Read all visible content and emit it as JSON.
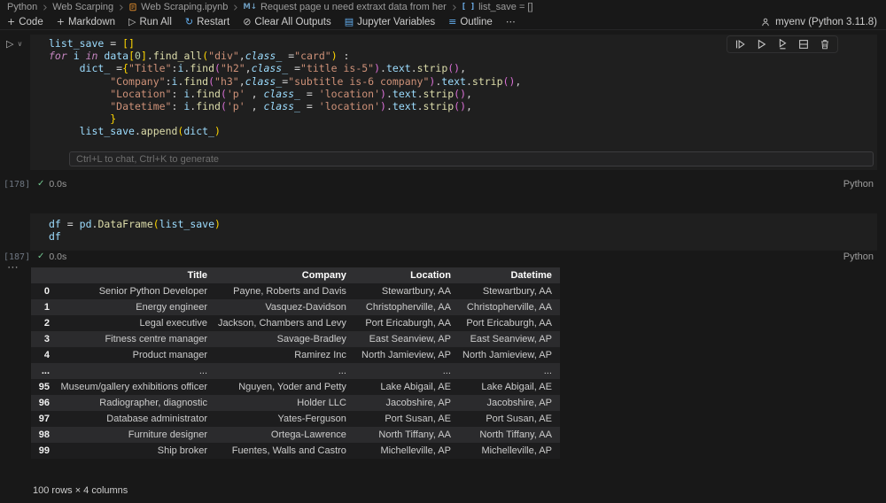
{
  "breadcrumbs": {
    "items": [
      {
        "label": "Python"
      },
      {
        "label": "Web Scarping"
      },
      {
        "label": "Web Scraping.ipynb"
      },
      {
        "label": "Request page u need extraxt data from her"
      },
      {
        "label": "list_save = []"
      }
    ]
  },
  "toolbar": {
    "code_label": "Code",
    "markdown_label": "Markdown",
    "run_all_label": "Run All",
    "restart_label": "Restart",
    "clear_outputs_label": "Clear All Outputs",
    "jupyter_variables_label": "Jupyter Variables",
    "outline_label": "Outline",
    "kernel_label": "myenv (Python 3.11.8)"
  },
  "icons": {
    "plus": "+",
    "run_all": "▷",
    "restart": "↻",
    "clear": "⊘",
    "variables": "▤",
    "outline": "≡",
    "more": "⋯",
    "run_cell": "▷",
    "chevron_down": "∨",
    "check": "✓",
    "collapse_output": "⋯",
    "markdown": "M↓",
    "array": "[ ]"
  },
  "cell1": {
    "execution_count": "[178]",
    "status_time": "0.0s",
    "language": "Python",
    "inline_hint": "Ctrl+L to chat, Ctrl+K to generate",
    "lines": [
      [
        [
          "list_save",
          "v"
        ],
        [
          " ",
          "p"
        ],
        [
          "=",
          "p"
        ],
        [
          " ",
          "p"
        ],
        [
          "[]",
          "b1"
        ]
      ],
      [
        [
          "for",
          "k"
        ],
        [
          " ",
          "p"
        ],
        [
          "i",
          "v"
        ],
        [
          " ",
          "p"
        ],
        [
          "in",
          "k"
        ],
        [
          " ",
          "p"
        ],
        [
          "data",
          "v"
        ],
        [
          "[",
          "b1"
        ],
        [
          "0",
          "n"
        ],
        [
          "]",
          "b1"
        ],
        [
          ".",
          "p"
        ],
        [
          "find_all",
          "f"
        ],
        [
          "(",
          "b1"
        ],
        [
          "\"div\"",
          "s"
        ],
        [
          ",",
          "p"
        ],
        [
          "class_",
          "pi"
        ],
        [
          " =",
          "p"
        ],
        [
          "\"card\"",
          "s"
        ],
        [
          ")",
          "b1"
        ],
        [
          " :",
          "p"
        ]
      ],
      [
        [
          "     ",
          "p"
        ],
        [
          "dict_",
          "v"
        ],
        [
          " =",
          "p"
        ],
        [
          "{",
          "b1"
        ],
        [
          "\"Title\"",
          "s"
        ],
        [
          ":",
          "p"
        ],
        [
          "i",
          "v"
        ],
        [
          ".",
          "p"
        ],
        [
          "find",
          "f"
        ],
        [
          "(",
          "b2"
        ],
        [
          "\"h2\"",
          "s"
        ],
        [
          ",",
          "p"
        ],
        [
          "class_",
          "pi"
        ],
        [
          " =",
          "p"
        ],
        [
          "\"title is-5\"",
          "s"
        ],
        [
          ")",
          "b2"
        ],
        [
          ".",
          "p"
        ],
        [
          "text",
          "v"
        ],
        [
          ".",
          "p"
        ],
        [
          "strip",
          "f"
        ],
        [
          "()",
          "b2"
        ],
        [
          ",",
          "p"
        ]
      ],
      [
        [
          "          ",
          "p"
        ],
        [
          "\"Company\"",
          "s"
        ],
        [
          ":",
          "p"
        ],
        [
          "i",
          "v"
        ],
        [
          ".",
          "p"
        ],
        [
          "find",
          "f"
        ],
        [
          "(",
          "b2"
        ],
        [
          "\"h3\"",
          "s"
        ],
        [
          ",",
          "p"
        ],
        [
          "class_",
          "pi"
        ],
        [
          "=",
          "p"
        ],
        [
          "\"subtitle is-6 company\"",
          "s"
        ],
        [
          ")",
          "b2"
        ],
        [
          ".",
          "p"
        ],
        [
          "text",
          "v"
        ],
        [
          ".",
          "p"
        ],
        [
          "strip",
          "f"
        ],
        [
          "()",
          "b2"
        ],
        [
          ",",
          "p"
        ]
      ],
      [
        [
          "          ",
          "p"
        ],
        [
          "\"Location\"",
          "s"
        ],
        [
          ": ",
          "p"
        ],
        [
          "i",
          "v"
        ],
        [
          ".",
          "p"
        ],
        [
          "find",
          "f"
        ],
        [
          "(",
          "b2"
        ],
        [
          "'p'",
          "s"
        ],
        [
          " , ",
          "p"
        ],
        [
          "class_",
          "pi"
        ],
        [
          " = ",
          "p"
        ],
        [
          "'location'",
          "s"
        ],
        [
          ")",
          "b2"
        ],
        [
          ".",
          "p"
        ],
        [
          "text",
          "v"
        ],
        [
          ".",
          "p"
        ],
        [
          "strip",
          "f"
        ],
        [
          "()",
          "b2"
        ],
        [
          ",",
          "p"
        ]
      ],
      [
        [
          "          ",
          "p"
        ],
        [
          "\"Datetime\"",
          "s"
        ],
        [
          ": ",
          "p"
        ],
        [
          "i",
          "v"
        ],
        [
          ".",
          "p"
        ],
        [
          "find",
          "f"
        ],
        [
          "(",
          "b2"
        ],
        [
          "'p'",
          "s"
        ],
        [
          " , ",
          "p"
        ],
        [
          "class_",
          "pi"
        ],
        [
          " = ",
          "p"
        ],
        [
          "'location'",
          "s"
        ],
        [
          ")",
          "b2"
        ],
        [
          ".",
          "p"
        ],
        [
          "text",
          "v"
        ],
        [
          ".",
          "p"
        ],
        [
          "strip",
          "f"
        ],
        [
          "()",
          "b2"
        ],
        [
          ",",
          "p"
        ]
      ],
      [
        [
          "          ",
          "p"
        ],
        [
          "}",
          "b1"
        ]
      ],
      [
        [
          "     ",
          "p"
        ],
        [
          "list_save",
          "v"
        ],
        [
          ".",
          "p"
        ],
        [
          "append",
          "f"
        ],
        [
          "(",
          "b1"
        ],
        [
          "dict_",
          "v"
        ],
        [
          ")",
          "b1"
        ]
      ]
    ]
  },
  "cell2": {
    "execution_count": "[187]",
    "status_time": "0.0s",
    "language": "Python",
    "lines": [
      [
        [
          "df",
          "v"
        ],
        [
          " ",
          "p"
        ],
        [
          "=",
          "p"
        ],
        [
          " ",
          "p"
        ],
        [
          "pd",
          "v"
        ],
        [
          ".",
          "p"
        ],
        [
          "DataFrame",
          "f"
        ],
        [
          "(",
          "b1"
        ],
        [
          "list_save",
          "v"
        ],
        [
          ")",
          "b1"
        ]
      ],
      [
        [
          "df",
          "v"
        ]
      ]
    ]
  },
  "output_table": {
    "columns": [
      "",
      "Title",
      "Company",
      "Location",
      "Datetime"
    ],
    "rows": [
      [
        "0",
        "Senior Python Developer",
        "Payne, Roberts and Davis",
        "Stewartbury, AA",
        "Stewartbury, AA"
      ],
      [
        "1",
        "Energy engineer",
        "Vasquez-Davidson",
        "Christopherville, AA",
        "Christopherville, AA"
      ],
      [
        "2",
        "Legal executive",
        "Jackson, Chambers and Levy",
        "Port Ericaburgh, AA",
        "Port Ericaburgh, AA"
      ],
      [
        "3",
        "Fitness centre manager",
        "Savage-Bradley",
        "East Seanview, AP",
        "East Seanview, AP"
      ],
      [
        "4",
        "Product manager",
        "Ramirez Inc",
        "North Jamieview, AP",
        "North Jamieview, AP"
      ],
      [
        "...",
        "...",
        "...",
        "...",
        "..."
      ],
      [
        "95",
        "Museum/gallery exhibitions officer",
        "Nguyen, Yoder and Petty",
        "Lake Abigail, AE",
        "Lake Abigail, AE"
      ],
      [
        "96",
        "Radiographer, diagnostic",
        "Holder LLC",
        "Jacobshire, AP",
        "Jacobshire, AP"
      ],
      [
        "97",
        "Database administrator",
        "Yates-Ferguson",
        "Port Susan, AE",
        "Port Susan, AE"
      ],
      [
        "98",
        "Furniture designer",
        "Ortega-Lawrence",
        "North Tiffany, AA",
        "North Tiffany, AA"
      ],
      [
        "99",
        "Ship broker",
        "Fuentes, Walls and Castro",
        "Michelleville, AP",
        "Michelleville, AP"
      ]
    ],
    "footer": "100 rows × 4 columns"
  }
}
